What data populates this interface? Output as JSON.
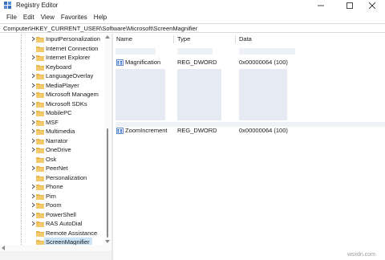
{
  "window": {
    "title": "Registry Editor",
    "icon": "registry-editor-icon"
  },
  "menu": [
    "File",
    "Edit",
    "View",
    "Favorites",
    "Help"
  ],
  "address": "Computer\\HKEY_CURRENT_USER\\Software\\Microsoft\\ScreenMagnifier",
  "tree": [
    {
      "label": "InputPersonalization",
      "expandable": true
    },
    {
      "label": "Internet Connection",
      "expandable": false
    },
    {
      "label": "Internet Explorer",
      "expandable": true
    },
    {
      "label": "Keyboard",
      "expandable": false
    },
    {
      "label": "LanguageOverlay",
      "expandable": true
    },
    {
      "label": "MediaPlayer",
      "expandable": true
    },
    {
      "label": "Microsoft Managem",
      "expandable": true
    },
    {
      "label": "Microsoft SDKs",
      "expandable": true
    },
    {
      "label": "MobilePC",
      "expandable": true
    },
    {
      "label": "MSF",
      "expandable": true
    },
    {
      "label": "Multimedia",
      "expandable": true
    },
    {
      "label": "Narrator",
      "expandable": true
    },
    {
      "label": "OneDrive",
      "expandable": true
    },
    {
      "label": "Osk",
      "expandable": false
    },
    {
      "label": "PeerNet",
      "expandable": true
    },
    {
      "label": "Personalization",
      "expandable": false
    },
    {
      "label": "Phone",
      "expandable": true
    },
    {
      "label": "Pim",
      "expandable": true
    },
    {
      "label": "Poom",
      "expandable": true
    },
    {
      "label": "PowerShell",
      "expandable": true
    },
    {
      "label": "RAS AutoDial",
      "expandable": true
    },
    {
      "label": "Remote Assistance",
      "expandable": false
    },
    {
      "label": "ScreenMagnifier",
      "expandable": false,
      "selected": true
    }
  ],
  "columns": {
    "name": "Name",
    "type": "Type",
    "data": "Data"
  },
  "values": [
    {
      "name": "Magnification",
      "type": "REG_DWORD",
      "data": "0x00000064 (100)"
    },
    {
      "name": "ZoomIncrement",
      "type": "REG_DWORD",
      "data": "0x00000064 (100)"
    }
  ],
  "watermark": "wsxdn.com",
  "colors": {
    "folder": "#e8b64c",
    "selection": "#cce4f7",
    "reg_icon": "#3a6fc4"
  }
}
